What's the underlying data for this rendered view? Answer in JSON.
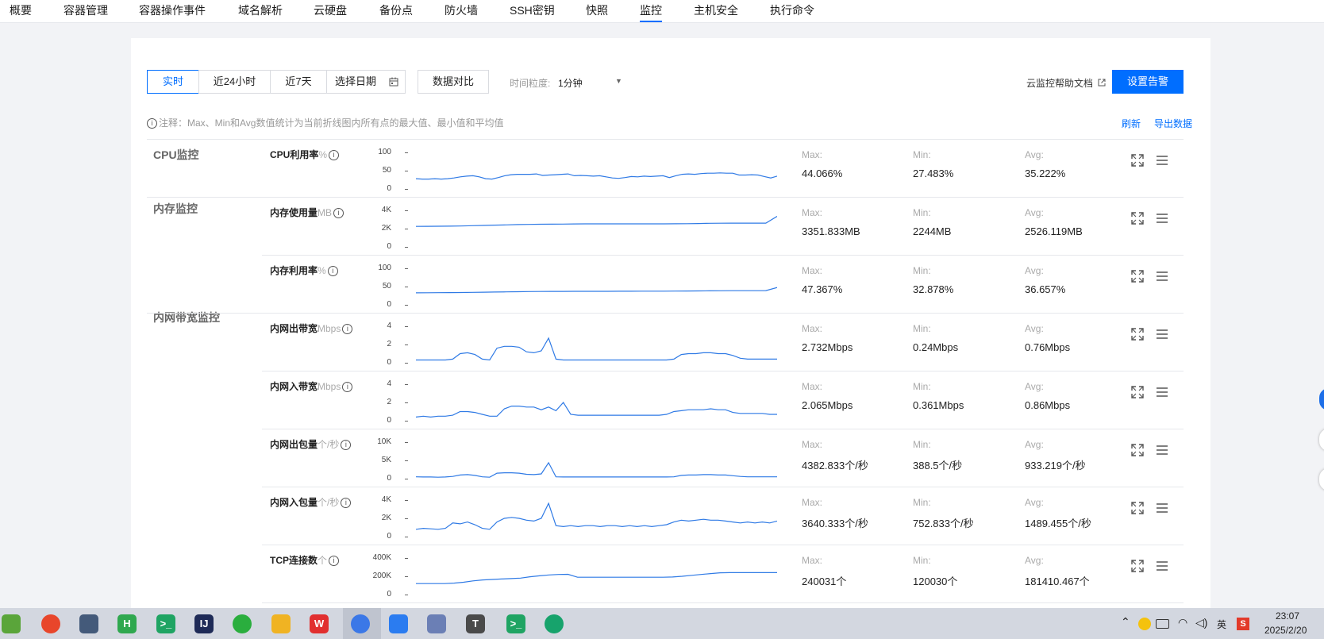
{
  "nav": {
    "tabs": [
      "概要",
      "容器管理",
      "容器操作事件",
      "域名解析",
      "云硬盘",
      "备份点",
      "防火墙",
      "SSH密钥",
      "快照",
      "监控",
      "主机安全",
      "执行命令"
    ],
    "active": "监控"
  },
  "toolbar": {
    "realtime": "实时",
    "last24h": "近24小时",
    "last7d": "近7天",
    "date_picker": "选择日期",
    "compare": "数据对比",
    "granularity_label": "时间粒度:",
    "granularity_value": "1分钟",
    "help_link": "云监控帮助文档",
    "alarm_button": "设置告警"
  },
  "note": {
    "text": "注释：Max、Min和Avg数值统计为当前折线图内所有点的最大值、最小值和平均值",
    "refresh": "刷新",
    "export": "导出数据"
  },
  "groups": [
    "CPU监控",
    "内存监控",
    "内网带宽监控"
  ],
  "stat_labels": {
    "max": "Max:",
    "min": "Min:",
    "avg": "Avg:"
  },
  "metrics": [
    {
      "name": "CPU利用率",
      "unit": "%",
      "ticks": [
        "100",
        "50",
        "0"
      ],
      "max": "44.066%",
      "min": "27.483%",
      "avg": "35.222%",
      "series": [
        28,
        27,
        27,
        28,
        27,
        28,
        30,
        33,
        35,
        36,
        33,
        28,
        27,
        31,
        36,
        39,
        40,
        40,
        40,
        41,
        37,
        38,
        39,
        40,
        41,
        36,
        37,
        36,
        35,
        36,
        33,
        30,
        29,
        31,
        34,
        33,
        35,
        34,
        35,
        36,
        31,
        36,
        40,
        41,
        40,
        42,
        43,
        43,
        44,
        43,
        43,
        38,
        38,
        39,
        38,
        34,
        30,
        35
      ],
      "ymax": 100
    },
    {
      "name": "内存使用量",
      "unit": "MB",
      "ticks": [
        "4K",
        "2K",
        "0"
      ],
      "max": "3351.833MB",
      "min": "2244MB",
      "avg": "2526.119MB",
      "series": [
        2244,
        2250,
        2260,
        2270,
        2290,
        2320,
        2350,
        2380,
        2410,
        2440,
        2460,
        2480,
        2490,
        2500,
        2510,
        2520,
        2520,
        2520,
        2525,
        2525,
        2525,
        2525,
        2525,
        2530,
        2540,
        2560,
        2580,
        2590,
        2600,
        2600,
        2600,
        2600,
        3351
      ],
      "ymax": 4000
    },
    {
      "name": "内存利用率",
      "unit": "%",
      "ticks": [
        "100",
        "50",
        "0"
      ],
      "max": "47.367%",
      "min": "32.878%",
      "avg": "36.657%",
      "series": [
        32.9,
        33,
        33.2,
        33.5,
        33.8,
        34.2,
        34.6,
        35,
        35.4,
        35.8,
        36.2,
        36.5,
        36.7,
        36.8,
        36.9,
        37,
        37,
        37,
        37.1,
        37.2,
        37.3,
        37.4,
        37.5,
        37.6,
        37.8,
        38,
        38.2,
        38.4,
        38.6,
        38.7,
        38.8,
        38.9,
        47.4
      ],
      "ymax": 100
    },
    {
      "name": "内网出带宽",
      "unit": "Mbps",
      "ticks": [
        "4",
        "2",
        "0"
      ],
      "max": "2.732Mbps",
      "min": "0.24Mbps",
      "avg": "0.76Mbps",
      "series": [
        0.3,
        0.3,
        0.3,
        0.3,
        0.3,
        0.4,
        1,
        1.1,
        0.9,
        0.4,
        0.3,
        1.6,
        1.8,
        1.8,
        1.7,
        1.2,
        1.1,
        1.3,
        2.7,
        0.4,
        0.3,
        0.3,
        0.3,
        0.3,
        0.3,
        0.3,
        0.3,
        0.3,
        0.3,
        0.3,
        0.3,
        0.3,
        0.3,
        0.3,
        0.3,
        0.4,
        0.9,
        1,
        1,
        1.1,
        1.1,
        1,
        1,
        0.8,
        0.5,
        0.4,
        0.4,
        0.4,
        0.4,
        0.4
      ],
      "ymax": 4
    },
    {
      "name": "内网入带宽",
      "unit": "Mbps",
      "ticks": [
        "4",
        "2",
        "0"
      ],
      "max": "2.065Mbps",
      "min": "0.361Mbps",
      "avg": "0.86Mbps",
      "series": [
        0.4,
        0.5,
        0.4,
        0.5,
        0.5,
        0.6,
        1,
        1,
        0.9,
        0.7,
        0.5,
        0.5,
        1.3,
        1.6,
        1.6,
        1.5,
        1.5,
        1.2,
        1.5,
        1.1,
        2,
        0.7,
        0.6,
        0.6,
        0.6,
        0.6,
        0.6,
        0.6,
        0.6,
        0.6,
        0.6,
        0.6,
        0.6,
        0.6,
        0.7,
        1,
        1.1,
        1.2,
        1.2,
        1.2,
        1.3,
        1.2,
        1.2,
        0.9,
        0.8,
        0.8,
        0.8,
        0.8,
        0.7,
        0.7
      ],
      "ymax": 4
    },
    {
      "name": "内网出包量",
      "unit": "个/秒",
      "ticks": [
        "10K",
        "5K",
        "0"
      ],
      "max": "4382.833个/秒",
      "min": "388.5个/秒",
      "avg": "933.219个/秒",
      "series": [
        500,
        450,
        450,
        400,
        450,
        600,
        1000,
        1100,
        900,
        500,
        400,
        1500,
        1600,
        1600,
        1500,
        1200,
        1100,
        1300,
        4380,
        500,
        450,
        450,
        450,
        450,
        450,
        450,
        450,
        450,
        450,
        450,
        450,
        450,
        450,
        450,
        450,
        500,
        900,
        1000,
        1000,
        1100,
        1100,
        1000,
        1000,
        800,
        600,
        500,
        500,
        500,
        500,
        500
      ],
      "ymax": 10000
    },
    {
      "name": "内网入包量",
      "unit": "个/秒",
      "ticks": [
        "4K",
        "2K",
        "0"
      ],
      "max": "3640.333个/秒",
      "min": "752.833个/秒",
      "avg": "1489.455个/秒",
      "series": [
        800,
        900,
        850,
        800,
        900,
        1500,
        1400,
        1600,
        1300,
        900,
        800,
        1600,
        2000,
        2100,
        2000,
        1800,
        1700,
        2000,
        3640,
        1200,
        1100,
        1200,
        1100,
        1200,
        1200,
        1100,
        1200,
        1200,
        1100,
        1200,
        1100,
        1200,
        1100,
        1200,
        1300,
        1600,
        1800,
        1700,
        1800,
        1900,
        1800,
        1800,
        1700,
        1600,
        1500,
        1600,
        1500,
        1600,
        1500,
        1700
      ],
      "ymax": 4000
    },
    {
      "name": "TCP连接数",
      "unit": "个",
      "ticks": [
        "400K",
        "200K",
        "0"
      ],
      "max": "240031个",
      "min": "120030个",
      "avg": "181410.467个",
      "series": [
        120030,
        120030,
        120030,
        120030,
        125000,
        135000,
        150000,
        160000,
        165000,
        170000,
        175000,
        180000,
        195000,
        205000,
        215000,
        220000,
        222000,
        190000,
        190000,
        190000,
        190000,
        190000,
        190000,
        190000,
        190000,
        190000,
        190000,
        192000,
        200000,
        210000,
        220000,
        230000,
        238000,
        240000,
        240000,
        240000,
        240000,
        240000,
        240031
      ],
      "ymax": 400000
    }
  ],
  "taskbar": {
    "time": "23:07",
    "date": "2025/2/20",
    "ime": "英",
    "apps": [
      {
        "name": "notepad-app",
        "label": "",
        "color": "#5aa53a"
      },
      {
        "name": "orange-snail-app",
        "label": "",
        "color": "#e8462b"
      },
      {
        "name": "lock-app",
        "label": "",
        "color": "#445a7a"
      },
      {
        "name": "hbuilder-app",
        "label": "H",
        "color": "#2fa84f"
      },
      {
        "name": "xshell-app",
        "label": ">_",
        "color": "#1fa463"
      },
      {
        "name": "intellij-app",
        "label": "IJ",
        "color": "#1e2a57"
      },
      {
        "name": "wechat-app",
        "label": "",
        "color": "#2aae3e"
      },
      {
        "name": "qq-app",
        "label": "",
        "color": "#f0b323"
      },
      {
        "name": "wps-app",
        "label": "W",
        "color": "#e12f2f"
      },
      {
        "name": "chrome-app",
        "label": "",
        "color": "#3b78e7"
      },
      {
        "name": "meeting-app",
        "label": "",
        "color": "#2b7cf0"
      },
      {
        "name": "avatar-app",
        "label": "",
        "color": "#6b7fb5"
      },
      {
        "name": "typora-app",
        "label": "T",
        "color": "#4a4a4a"
      },
      {
        "name": "xftp-app",
        "label": ">_",
        "color": "#1fa463"
      },
      {
        "name": "tool-app",
        "label": "",
        "color": "#17a36c"
      }
    ]
  }
}
